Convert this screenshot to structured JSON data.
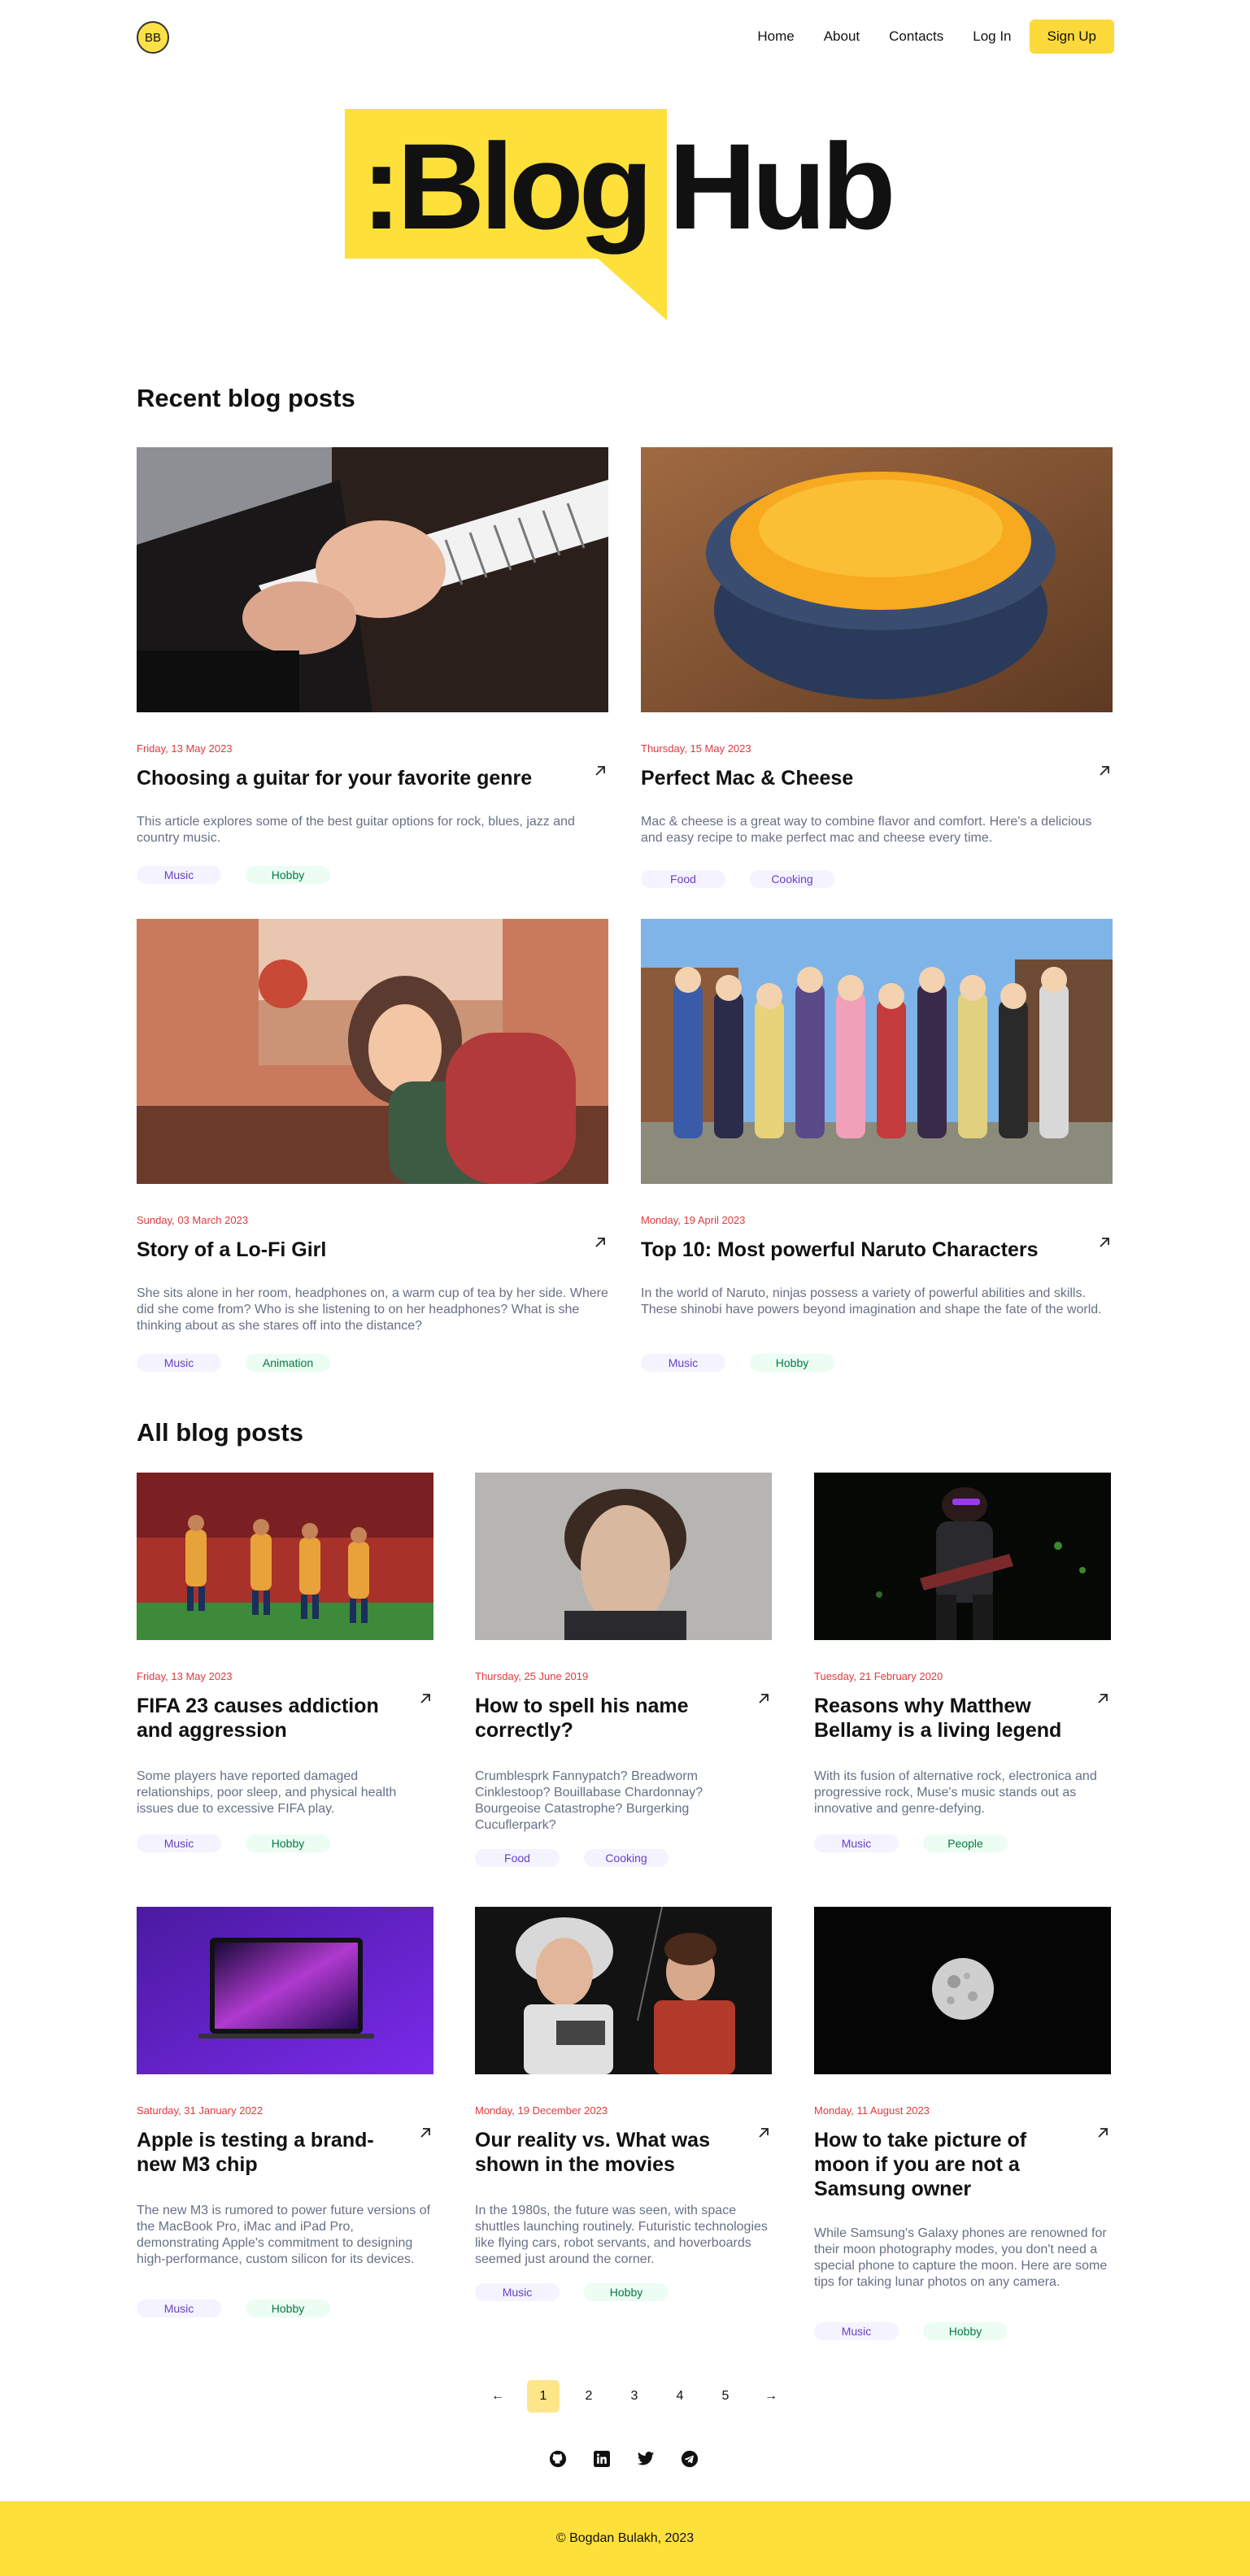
{
  "header": {
    "avatar": "BB",
    "nav": [
      "Home",
      "About",
      "Contacts",
      "Log In"
    ],
    "signup": "Sign Up"
  },
  "logo": {
    "part1": ":Blog",
    "part2": "Hub"
  },
  "recent": {
    "heading": "Recent blog posts",
    "posts": [
      {
        "date": "Friday, 13 May 2023",
        "title": "Choosing a guitar for your favorite genre",
        "desc": "This article explores some of the best guitar options for rock, blues, jazz and country music.",
        "tags": [
          "Music",
          "Hobby"
        ],
        "image": "guitar"
      },
      {
        "date": "Thursday, 15 May 2023",
        "title": "Perfect Mac & Cheese",
        "desc": "Mac & cheese is a great way to combine flavor and comfort. Here's a delicious and easy recipe to make perfect mac and cheese every time.",
        "tags": [
          "Food",
          "Cooking"
        ],
        "image": "mac-cheese"
      },
      {
        "date": "Sunday, 03 March 2023",
        "title": "Story of a Lo-Fi Girl",
        "desc": "She sits alone in her room, headphones on, a warm cup of tea by her side. Where did she come from? Who is she listening to on her headphones? What is she thinking about as she stares off into the distance?",
        "tags": [
          "Music",
          "Animation"
        ],
        "image": "lofi"
      },
      {
        "date": "Monday, 19 April 2023",
        "title": "Top 10: Most powerful Naruto Characters",
        "desc": "In the world of Naruto, ninjas possess a variety of powerful abilities and skills. These shinobi have powers beyond imagination and shape the fate of the world.",
        "tags": [
          "Music",
          "Hobby"
        ],
        "image": "naruto"
      }
    ]
  },
  "all": {
    "heading": "All blog posts",
    "posts": [
      {
        "date": "Friday, 13 May 2023",
        "title": "FIFA 23 causes addiction and aggression",
        "desc": "Some players have reported damaged relationships, poor sleep, and physical health issues due to excessive FIFA play.",
        "tags": [
          "Music",
          "Hobby"
        ],
        "image": "fifa"
      },
      {
        "date": "Thursday, 25 June 2019",
        "title": "How to spell his name correctly?",
        "desc": "Crumblesprk Fannypatch? Breadworm Cinklestoop? Bouillabase Chardonnay? Bourgeoise Catastrophe? Burgerking Cucuflerpark?",
        "tags": [
          "Food",
          "Cooking"
        ],
        "image": "actor"
      },
      {
        "date": "Tuesday, 21 February 2020",
        "title": "Reasons why Matthew Bellamy is a living legend",
        "desc": "With its fusion of alternative rock, electronica and progressive rock, Muse's music stands out as innovative and genre-defying.",
        "tags": [
          "Music",
          "People"
        ],
        "image": "muse"
      },
      {
        "date": "Saturday, 31 January 2022",
        "title": "Apple is testing a brand-new M3 chip",
        "desc": "The new M3 is rumored to power future versions of the MacBook Pro, iMac and iPad Pro, demonstrating Apple's commitment to designing high-performance, custom silicon for its devices.",
        "tags": [
          "Music",
          "Hobby"
        ],
        "image": "macbook"
      },
      {
        "date": "Monday, 19 December 2023",
        "title": "Our reality vs. What was shown in the movies",
        "desc": "In the 1980s, the future was seen, with space shuttles launching routinely. Futuristic technologies like flying cars, robot servants, and hoverboards seemed just around the corner.",
        "tags": [
          "Music",
          "Hobby"
        ],
        "image": "bttf"
      },
      {
        "date": "Monday, 11 August 2023",
        "title": "How to take picture of moon if you are not a Samsung owner",
        "desc": "While Samsung's Galaxy phones are renowned for their moon photography modes, you don't need a special phone to capture the moon. Here are some tips for taking lunar photos on any camera.",
        "tags": [
          "Music",
          "Hobby"
        ],
        "image": "moon"
      }
    ]
  },
  "pagination": {
    "prev": "←",
    "pages": [
      "1",
      "2",
      "3",
      "4",
      "5"
    ],
    "next": "→",
    "current": "1"
  },
  "social": [
    "github-icon",
    "linkedin-icon",
    "twitter-icon",
    "telegram-icon"
  ],
  "footer": {
    "text": "© Bogdan Bulakh, 2023"
  },
  "colors": {
    "accent": "#fde03a",
    "date": "#e0393e"
  }
}
